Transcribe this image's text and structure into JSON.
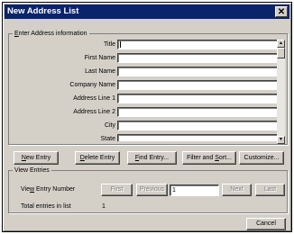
{
  "window": {
    "title": "New Address List",
    "close": "✕"
  },
  "address_group": {
    "legend_u": "E",
    "legend_rest": "nter Address information",
    "fields": [
      {
        "label": "Title",
        "value": ""
      },
      {
        "label": "First Name",
        "value": ""
      },
      {
        "label": "Last Name",
        "value": ""
      },
      {
        "label": "Company Name",
        "value": ""
      },
      {
        "label": "Address Line 1",
        "value": ""
      },
      {
        "label": "Address Line 2",
        "value": ""
      },
      {
        "label": "City",
        "value": ""
      },
      {
        "label": "State",
        "value": ""
      }
    ],
    "scroll_up": "▲",
    "scroll_down": "▼"
  },
  "actions": {
    "new_entry_u": "N",
    "new_entry_rest": "ew Entry",
    "delete_entry_u": "D",
    "delete_entry_rest": "elete Entry",
    "find_entry_u": "F",
    "find_entry_rest": "ind Entry...",
    "filter_pre": "Filter and ",
    "filter_u": "S",
    "filter_rest": "ort...",
    "customize": "Customize..."
  },
  "view_entries": {
    "legend": "View Entries",
    "entry_label_pre": "Vie",
    "entry_label_u": "w",
    "entry_label_rest": " Entry Number",
    "first": "First",
    "previous": "Previous",
    "entry_number": "1",
    "next": "Next",
    "last": "Last",
    "total_label": "Total entries in list",
    "total_value": "1"
  },
  "footer": {
    "cancel": "Cancel"
  }
}
